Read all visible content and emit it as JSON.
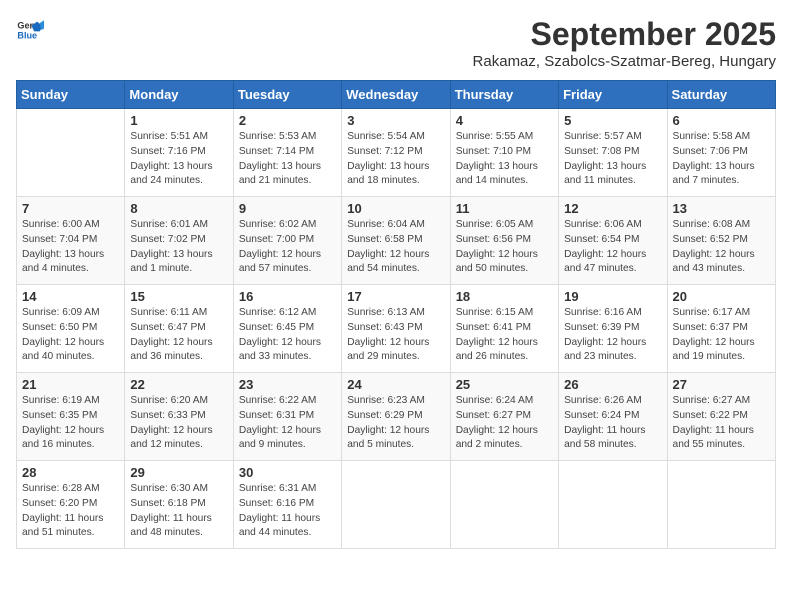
{
  "header": {
    "logo_general": "General",
    "logo_blue": "Blue",
    "month_title": "September 2025",
    "location": "Rakamaz, Szabolcs-Szatmar-Bereg, Hungary"
  },
  "days_of_week": [
    "Sunday",
    "Monday",
    "Tuesday",
    "Wednesday",
    "Thursday",
    "Friday",
    "Saturday"
  ],
  "weeks": [
    [
      {
        "day": "",
        "info": ""
      },
      {
        "day": "1",
        "info": "Sunrise: 5:51 AM\nSunset: 7:16 PM\nDaylight: 13 hours\nand 24 minutes."
      },
      {
        "day": "2",
        "info": "Sunrise: 5:53 AM\nSunset: 7:14 PM\nDaylight: 13 hours\nand 21 minutes."
      },
      {
        "day": "3",
        "info": "Sunrise: 5:54 AM\nSunset: 7:12 PM\nDaylight: 13 hours\nand 18 minutes."
      },
      {
        "day": "4",
        "info": "Sunrise: 5:55 AM\nSunset: 7:10 PM\nDaylight: 13 hours\nand 14 minutes."
      },
      {
        "day": "5",
        "info": "Sunrise: 5:57 AM\nSunset: 7:08 PM\nDaylight: 13 hours\nand 11 minutes."
      },
      {
        "day": "6",
        "info": "Sunrise: 5:58 AM\nSunset: 7:06 PM\nDaylight: 13 hours\nand 7 minutes."
      }
    ],
    [
      {
        "day": "7",
        "info": "Sunrise: 6:00 AM\nSunset: 7:04 PM\nDaylight: 13 hours\nand 4 minutes."
      },
      {
        "day": "8",
        "info": "Sunrise: 6:01 AM\nSunset: 7:02 PM\nDaylight: 13 hours\nand 1 minute."
      },
      {
        "day": "9",
        "info": "Sunrise: 6:02 AM\nSunset: 7:00 PM\nDaylight: 12 hours\nand 57 minutes."
      },
      {
        "day": "10",
        "info": "Sunrise: 6:04 AM\nSunset: 6:58 PM\nDaylight: 12 hours\nand 54 minutes."
      },
      {
        "day": "11",
        "info": "Sunrise: 6:05 AM\nSunset: 6:56 PM\nDaylight: 12 hours\nand 50 minutes."
      },
      {
        "day": "12",
        "info": "Sunrise: 6:06 AM\nSunset: 6:54 PM\nDaylight: 12 hours\nand 47 minutes."
      },
      {
        "day": "13",
        "info": "Sunrise: 6:08 AM\nSunset: 6:52 PM\nDaylight: 12 hours\nand 43 minutes."
      }
    ],
    [
      {
        "day": "14",
        "info": "Sunrise: 6:09 AM\nSunset: 6:50 PM\nDaylight: 12 hours\nand 40 minutes."
      },
      {
        "day": "15",
        "info": "Sunrise: 6:11 AM\nSunset: 6:47 PM\nDaylight: 12 hours\nand 36 minutes."
      },
      {
        "day": "16",
        "info": "Sunrise: 6:12 AM\nSunset: 6:45 PM\nDaylight: 12 hours\nand 33 minutes."
      },
      {
        "day": "17",
        "info": "Sunrise: 6:13 AM\nSunset: 6:43 PM\nDaylight: 12 hours\nand 29 minutes."
      },
      {
        "day": "18",
        "info": "Sunrise: 6:15 AM\nSunset: 6:41 PM\nDaylight: 12 hours\nand 26 minutes."
      },
      {
        "day": "19",
        "info": "Sunrise: 6:16 AM\nSunset: 6:39 PM\nDaylight: 12 hours\nand 23 minutes."
      },
      {
        "day": "20",
        "info": "Sunrise: 6:17 AM\nSunset: 6:37 PM\nDaylight: 12 hours\nand 19 minutes."
      }
    ],
    [
      {
        "day": "21",
        "info": "Sunrise: 6:19 AM\nSunset: 6:35 PM\nDaylight: 12 hours\nand 16 minutes."
      },
      {
        "day": "22",
        "info": "Sunrise: 6:20 AM\nSunset: 6:33 PM\nDaylight: 12 hours\nand 12 minutes."
      },
      {
        "day": "23",
        "info": "Sunrise: 6:22 AM\nSunset: 6:31 PM\nDaylight: 12 hours\nand 9 minutes."
      },
      {
        "day": "24",
        "info": "Sunrise: 6:23 AM\nSunset: 6:29 PM\nDaylight: 12 hours\nand 5 minutes."
      },
      {
        "day": "25",
        "info": "Sunrise: 6:24 AM\nSunset: 6:27 PM\nDaylight: 12 hours\nand 2 minutes."
      },
      {
        "day": "26",
        "info": "Sunrise: 6:26 AM\nSunset: 6:24 PM\nDaylight: 11 hours\nand 58 minutes."
      },
      {
        "day": "27",
        "info": "Sunrise: 6:27 AM\nSunset: 6:22 PM\nDaylight: 11 hours\nand 55 minutes."
      }
    ],
    [
      {
        "day": "28",
        "info": "Sunrise: 6:28 AM\nSunset: 6:20 PM\nDaylight: 11 hours\nand 51 minutes."
      },
      {
        "day": "29",
        "info": "Sunrise: 6:30 AM\nSunset: 6:18 PM\nDaylight: 11 hours\nand 48 minutes."
      },
      {
        "day": "30",
        "info": "Sunrise: 6:31 AM\nSunset: 6:16 PM\nDaylight: 11 hours\nand 44 minutes."
      },
      {
        "day": "",
        "info": ""
      },
      {
        "day": "",
        "info": ""
      },
      {
        "day": "",
        "info": ""
      },
      {
        "day": "",
        "info": ""
      }
    ]
  ]
}
